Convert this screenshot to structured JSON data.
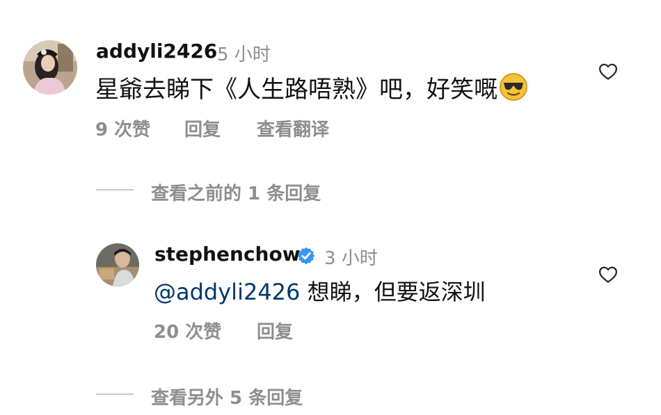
{
  "comments": [
    {
      "username": "addyli2426",
      "time": "5 小时",
      "text": "星爺去睇下《人生路唔熟》吧，好笑嘅",
      "emoji_icon": "sunglasses-emoji-icon",
      "likes": "9 次赞",
      "reply_label": "回复",
      "translate_label": "查看翻译",
      "verified": false
    },
    {
      "username": "stephenchow",
      "time": "3 小时",
      "mention": "@addyli2426",
      "text": "想睇，但要返深圳",
      "likes": "20 次赞",
      "reply_label": "回复",
      "verified": true
    }
  ],
  "thread": {
    "view_previous": "查看之前的 1 条回复",
    "view_more": "查看另外 5 条回复"
  },
  "colors": {
    "text": "#111111",
    "muted": "#8e8e8e",
    "mention": "#00376b",
    "verified": "#3897f0",
    "line": "#c7c7c7"
  },
  "icons": {
    "like": "heart-outline-icon",
    "verified": "verified-badge-icon"
  }
}
